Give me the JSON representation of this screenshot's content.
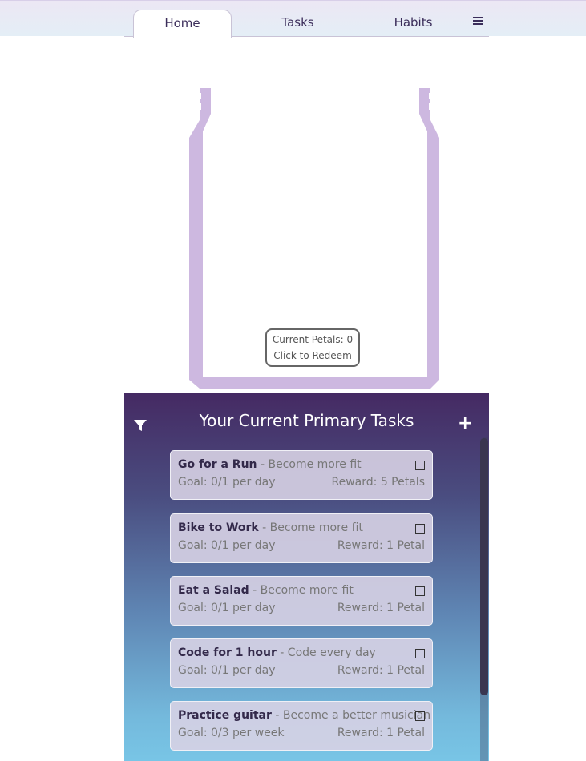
{
  "nav": {
    "tabs": [
      {
        "label": "Home",
        "active": true
      },
      {
        "label": "Tasks",
        "active": false
      },
      {
        "label": "Habits",
        "active": false
      }
    ],
    "menu_icon": "hamburger-menu-icon"
  },
  "jar": {
    "current_petals_label": "Current Petals: 0",
    "redeem_label": "Click to Redeem",
    "jar_color": "#cdb8e0"
  },
  "tasks_panel": {
    "title": "Your Current Primary Tasks",
    "filter_icon": "filter-icon",
    "add_icon": "plus-icon",
    "add_label": "+",
    "tasks": [
      {
        "name": "Go for a Run",
        "habit": " - Become more fit",
        "goal": "Goal: 0/1 per day",
        "reward": "Reward: 5 Petals"
      },
      {
        "name": "Bike to Work",
        "habit": " - Become more fit",
        "goal": "Goal: 0/1 per day",
        "reward": "Reward: 1 Petal"
      },
      {
        "name": "Eat a Salad",
        "habit": " - Become more fit",
        "goal": "Goal: 0/1 per day",
        "reward": "Reward: 1 Petal"
      },
      {
        "name": "Code for 1 hour",
        "habit": " - Code every day",
        "goal": "Goal: 0/1 per day",
        "reward": "Reward: 1 Petal"
      },
      {
        "name": "Practice guitar",
        "habit": " - Become a better musician",
        "goal": "Goal: 0/3 per week",
        "reward": "Reward: 1 Petal"
      }
    ]
  }
}
